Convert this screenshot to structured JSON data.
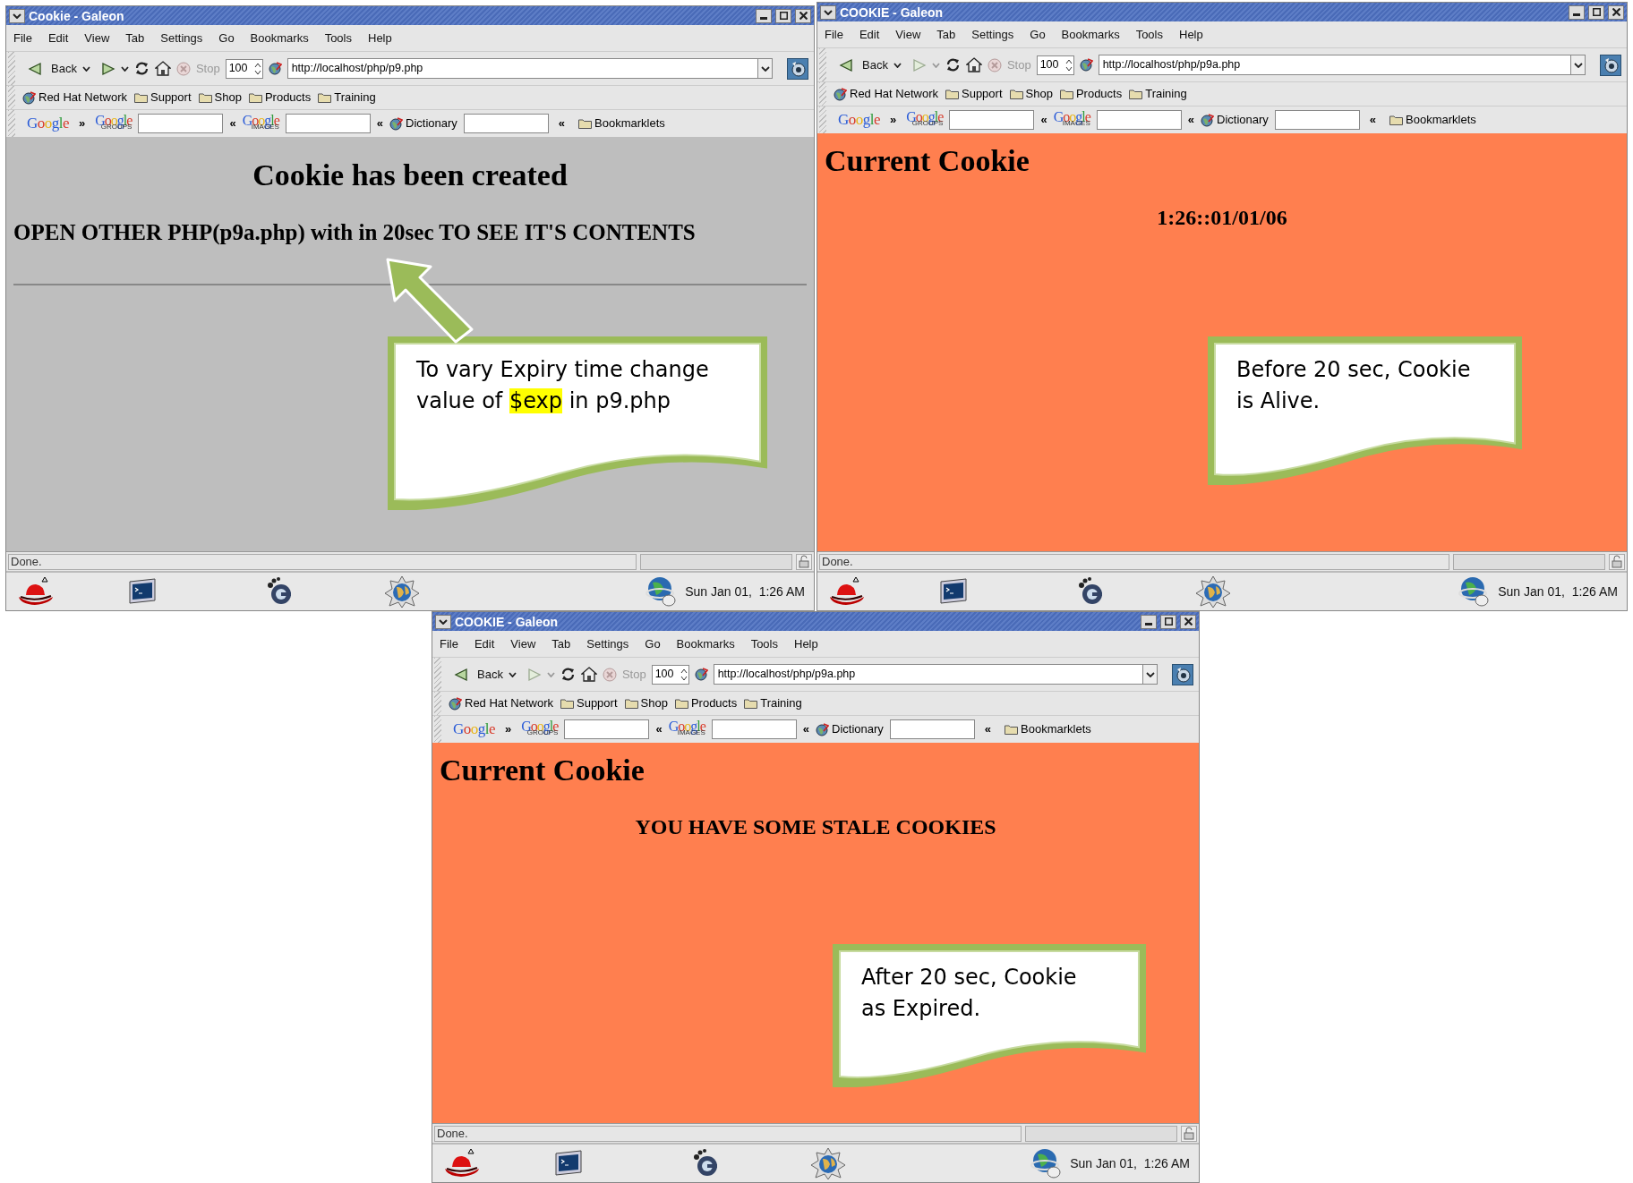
{
  "windows": [
    {
      "title": "Cookie - Galeon",
      "menu": [
        "File",
        "Edit",
        "View",
        "Tab",
        "Settings",
        "Go",
        "Bookmarks",
        "Tools",
        "Help"
      ],
      "toolbar": {
        "back": "Back",
        "forward_disabled": false,
        "stop": "Stop",
        "zoom": "100",
        "url": "http://localhost/php/p9.php"
      },
      "bookmarks": [
        {
          "label": "Red Hat Network",
          "kind": "site"
        },
        {
          "label": "Support",
          "kind": "folder"
        },
        {
          "label": "Shop",
          "kind": "folder"
        },
        {
          "label": "Products",
          "kind": "folder"
        },
        {
          "label": "Training",
          "kind": "folder"
        }
      ],
      "search_bar": {
        "google": "Google",
        "groups": [
          "Google",
          "GROUPS"
        ],
        "images": [
          "Google",
          "IMAGES"
        ],
        "dictionary": "Dictionary",
        "bookmarklets": "Bookmarklets",
        "chevron_right": "»",
        "chevron_left": "«"
      },
      "content": {
        "kind": "created",
        "heading": "Cookie has been created",
        "message": "OPEN OTHER PHP(p9a.php) with in 20sec TO SEE IT'S CONTENTS"
      },
      "status": "Done.",
      "progress": {
        "level": 0
      },
      "clock": "Sun Jan 01,  1:26 AM"
    },
    {
      "title": "COOKIE - Galeon",
      "menu": [
        "File",
        "Edit",
        "View",
        "Tab",
        "Settings",
        "Go",
        "Bookmarks",
        "Tools",
        "Help"
      ],
      "toolbar": {
        "back": "Back",
        "forward_disabled": true,
        "stop": "Stop",
        "zoom": "100",
        "url": "http://localhost/php/p9a.php"
      },
      "bookmarks": [
        {
          "label": "Red Hat Network",
          "kind": "site"
        },
        {
          "label": "Support",
          "kind": "folder"
        },
        {
          "label": "Shop",
          "kind": "folder"
        },
        {
          "label": "Products",
          "kind": "folder"
        },
        {
          "label": "Training",
          "kind": "folder"
        }
      ],
      "search_bar": {
        "google": "Google",
        "groups": [
          "Google",
          "GROUPS"
        ],
        "images": [
          "Google",
          "IMAGES"
        ],
        "dictionary": "Dictionary",
        "bookmarklets": "Bookmarklets",
        "chevron_right": "»",
        "chevron_left": "«"
      },
      "content": {
        "kind": "cookie",
        "heading": "Current Cookie",
        "message": "1:26::01/01/06"
      },
      "status": "Done.",
      "progress": {
        "level": 0
      },
      "clock": "Sun Jan 01,  1:26 AM"
    },
    {
      "title": "COOKIE - Galeon",
      "menu": [
        "File",
        "Edit",
        "View",
        "Tab",
        "Settings",
        "Go",
        "Bookmarks",
        "Tools",
        "Help"
      ],
      "toolbar": {
        "back": "Back",
        "forward_disabled": true,
        "stop": "Stop",
        "zoom": "100",
        "url": "http://localhost/php/p9a.php"
      },
      "bookmarks": [
        {
          "label": "Red Hat Network",
          "kind": "site"
        },
        {
          "label": "Support",
          "kind": "folder"
        },
        {
          "label": "Shop",
          "kind": "folder"
        },
        {
          "label": "Products",
          "kind": "folder"
        },
        {
          "label": "Training",
          "kind": "folder"
        }
      ],
      "search_bar": {
        "google": "Google",
        "groups": [
          "Google",
          "GROUPS"
        ],
        "images": [
          "Google",
          "IMAGES"
        ],
        "dictionary": "Dictionary",
        "bookmarklets": "Bookmarklets",
        "chevron_right": "»",
        "chevron_left": "«"
      },
      "content": {
        "kind": "cookie",
        "heading": "Current Cookie",
        "message": "YOU HAVE SOME STALE COOKIES"
      },
      "status": "Done.",
      "progress": {
        "level": 0
      },
      "clock": "Sun Jan 01,  1:26 AM"
    }
  ],
  "callouts": [
    {
      "pointer": true,
      "parts": [
        {
          "text": "To vary Expiry time change value of ",
          "highlighted": false
        },
        {
          "text": "$exp",
          "highlighted": true
        },
        {
          "text": " in p9.php",
          "highlighted": false
        }
      ]
    },
    {
      "pointer": false,
      "parts": [
        {
          "text": "Before 20 sec, Cookie is Alive.",
          "highlighted": false
        }
      ]
    },
    {
      "pointer": false,
      "parts": [
        {
          "text": "After 20 sec, Cookie as Expired.",
          "highlighted": false
        }
      ]
    }
  ]
}
